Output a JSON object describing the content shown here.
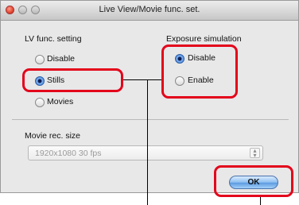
{
  "window": {
    "title": "Live View/Movie func. set."
  },
  "lv_func": {
    "heading": "LV func. setting",
    "options": [
      {
        "label": "Disable",
        "selected": false
      },
      {
        "label": "Stills",
        "selected": true
      },
      {
        "label": "Movies",
        "selected": false
      }
    ]
  },
  "exposure_sim": {
    "heading": "Exposure simulation",
    "options": [
      {
        "label": "Disable",
        "selected": true
      },
      {
        "label": "Enable",
        "selected": false
      }
    ]
  },
  "movie_rec": {
    "heading": "Movie rec. size",
    "selected_value": "1920x1080 30 fps"
  },
  "ok_button": {
    "label": "OK"
  },
  "colors": {
    "highlight": "#e3051b",
    "accent": "#3f7fd4"
  }
}
